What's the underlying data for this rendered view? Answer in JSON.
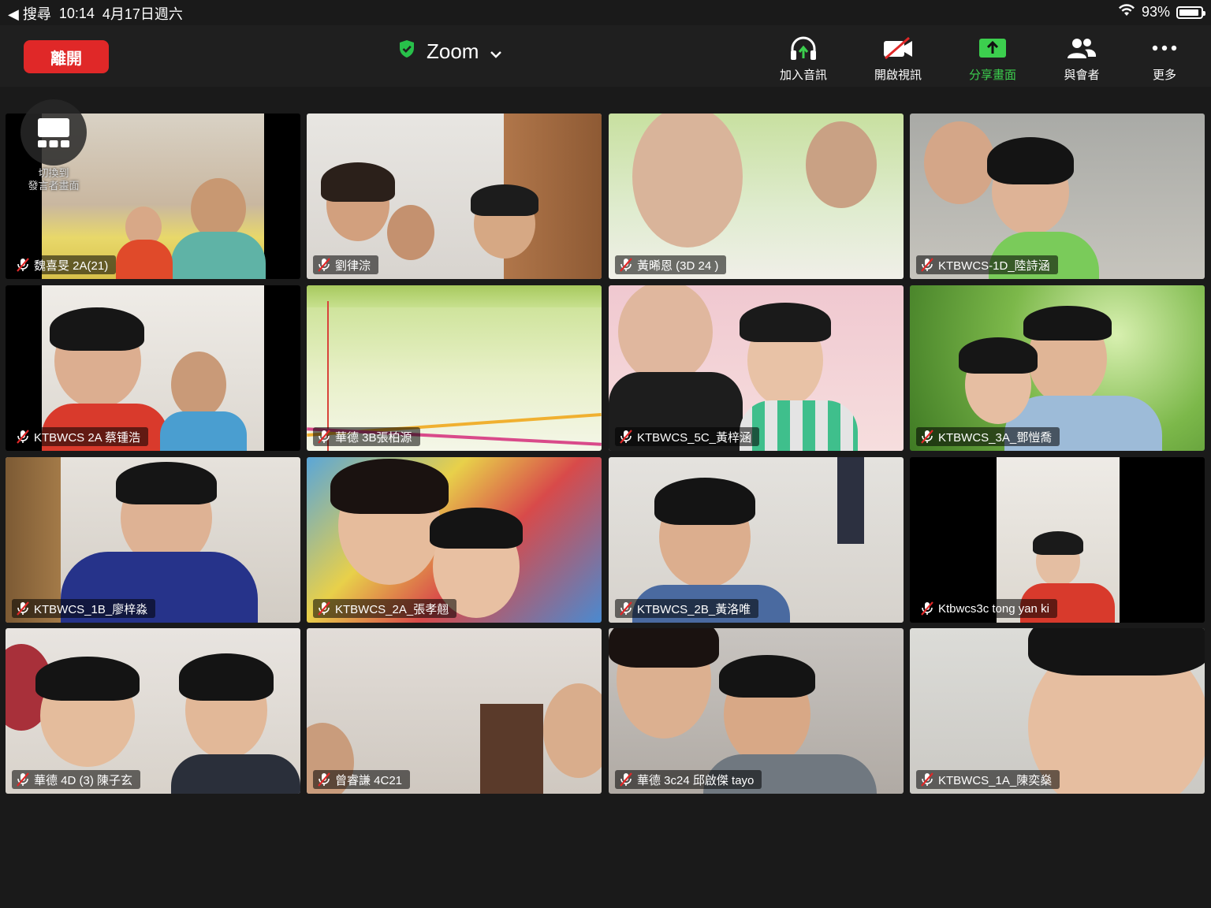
{
  "status_bar": {
    "back_label": "◀ 搜尋",
    "time": "10:14",
    "date": "4月17日週六",
    "battery": "93%",
    "battery_level": 0.93
  },
  "toolbar": {
    "leave_label": "離開",
    "meeting_title": "Zoom",
    "buttons": [
      {
        "label": "加入音訊",
        "icon": "headphones-icon"
      },
      {
        "label": "開啟視訊",
        "icon": "video-off-icon"
      },
      {
        "label": "分享畫面",
        "icon": "share-screen-icon",
        "color": "#3ccf4e"
      },
      {
        "label": "與會者",
        "icon": "participants-icon"
      },
      {
        "label": "更多",
        "icon": "more-icon"
      }
    ]
  },
  "switch_view": {
    "label_line1": "切換到",
    "label_line2": "發言者畫面"
  },
  "participants": [
    {
      "name": "魏喜旻 2A(21)"
    },
    {
      "name": "劉律淙"
    },
    {
      "name": "黃晞恩 (3D 24 )"
    },
    {
      "name": "KTBWCS-1D_陸詩涵"
    },
    {
      "name": "KTBWCS 2A 蔡锺浩"
    },
    {
      "name": "華德 3B張柏源"
    },
    {
      "name": "KTBWCS_5C_黃梓涵"
    },
    {
      "name": "KTBWCS_3A_鄧愷喬"
    },
    {
      "name": "KTBWCS_1B_廖梓淼"
    },
    {
      "name": "KTBWCS_2A_張孝翹"
    },
    {
      "name": "KTBWCS_2B_黃洛唯"
    },
    {
      "name": "Ktbwcs3c tong yan ki"
    },
    {
      "name": "華德 4D (3) 陳子玄"
    },
    {
      "name": "曾睿謙 4C21"
    },
    {
      "name": "華德 3c24 邱啟傑 tayo"
    },
    {
      "name": "KTBWCS_1A_陳奕燊"
    }
  ]
}
